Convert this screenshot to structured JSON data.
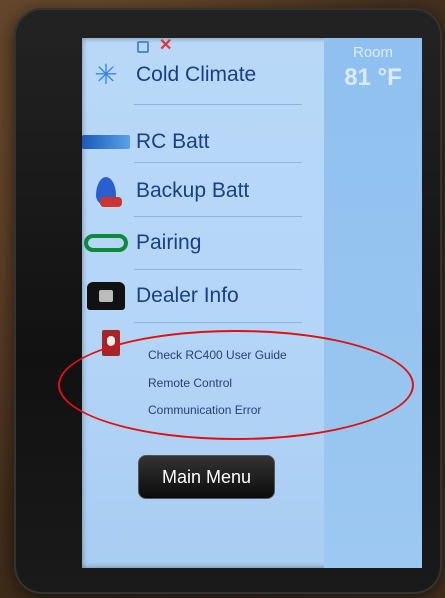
{
  "status_bar": {
    "icons": [
      "lock-icon",
      "close-icon"
    ],
    "close_glyph": "✕"
  },
  "room": {
    "label": "Room",
    "temperature": "81 °F"
  },
  "menu": {
    "items": [
      {
        "label": "Cold Climate",
        "icon": "snowflake-icon"
      },
      {
        "label": "RC Batt",
        "icon": "battery-icon"
      },
      {
        "label": "Backup Batt",
        "icon": "flame-icon"
      },
      {
        "label": "Pairing",
        "icon": "pairing-icon"
      },
      {
        "label": "Dealer Info",
        "icon": "phone-icon"
      }
    ]
  },
  "message": {
    "icon": "guide-book-icon",
    "lines": [
      "Check RC400 User Guide",
      "Remote Control",
      "Communication Error"
    ]
  },
  "main_menu_button": {
    "label": "Main Menu"
  },
  "colors": {
    "screen_bg": "#b9d8f7",
    "label_text": "#1b3f86",
    "highlight_ellipse": "#e01010"
  }
}
